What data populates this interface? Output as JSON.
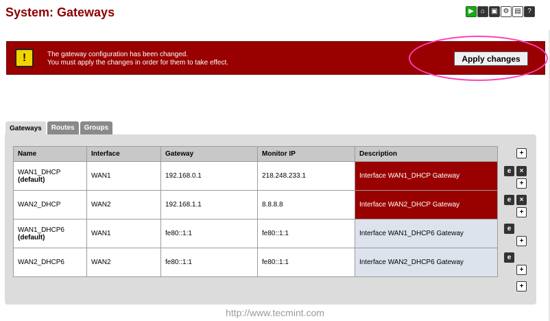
{
  "page": {
    "title": "System: Gateways"
  },
  "top_icons": [
    {
      "name": "play-icon",
      "glyph": "▶"
    },
    {
      "name": "home-icon",
      "glyph": "⌂"
    },
    {
      "name": "status-icon",
      "glyph": "▣"
    },
    {
      "name": "gear-icon",
      "glyph": "⚙"
    },
    {
      "name": "log-icon",
      "glyph": "▤"
    },
    {
      "name": "help-icon",
      "glyph": "?"
    }
  ],
  "alert": {
    "icon_glyph": "!",
    "line1": "The gateway configuration has been changed.",
    "line2": "You must apply the changes in order for them to take effect.",
    "apply_label": "Apply changes"
  },
  "tabs": [
    {
      "label": "Gateways",
      "active": true
    },
    {
      "label": "Routes",
      "active": false
    },
    {
      "label": "Groups",
      "active": false
    }
  ],
  "table": {
    "headers": [
      "Name",
      "Interface",
      "Gateway",
      "Monitor IP",
      "Description"
    ],
    "rows": [
      {
        "name": "WAN1_DHCP",
        "default": "(default)",
        "interface": "WAN1",
        "gateway": "192.168.0.1",
        "monitor_ip": "218.248.233.1",
        "description": "Interface WAN1_DHCP Gateway"
      },
      {
        "name": "WAN2_DHCP",
        "default": "",
        "interface": "WAN2",
        "gateway": "192.168.1.1",
        "monitor_ip": "8.8.8.8",
        "description": "Interface WAN2_DHCP Gateway"
      },
      {
        "name": "WAN1_DHCP6",
        "default": "(default)",
        "interface": "WAN1",
        "gateway": "fe80::1:1",
        "monitor_ip": "fe80::1:1",
        "description": "Interface WAN1_DHCP6 Gateway"
      },
      {
        "name": "WAN2_DHCP6",
        "default": "",
        "interface": "WAN2",
        "gateway": "fe80::1:1",
        "monitor_ip": "fe80::1:1",
        "description": "Interface WAN2_DHCP6 Gateway"
      }
    ]
  },
  "action_glyphs": {
    "add": "+",
    "edit": "e",
    "delete": "×"
  },
  "watermark": "http://www.tecmint.com",
  "colors": {
    "accent_red": "#990000",
    "title_red": "#8b0000",
    "highlight": "#ff40b8"
  }
}
